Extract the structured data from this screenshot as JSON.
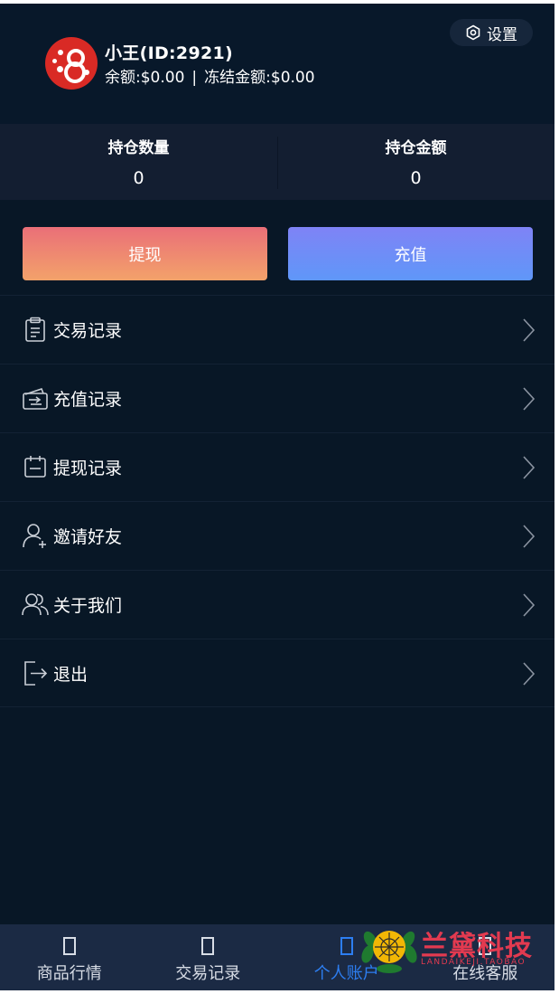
{
  "header": {
    "username": "小王(ID:2921)",
    "balance_label": "余额:",
    "balance_value": "$0.00",
    "separator": "|",
    "frozen_label": "冻结金额:",
    "frozen_value": "$0.00",
    "settings_label": "设置",
    "settings_icon": "gear-icon",
    "avatar_color": "#d92a25"
  },
  "stats": [
    {
      "label": "持仓数量",
      "value": "0"
    },
    {
      "label": "持仓金额",
      "value": "0"
    }
  ],
  "actions": {
    "withdraw_label": "提现",
    "recharge_label": "充值"
  },
  "menu": [
    {
      "label": "交易记录",
      "icon": "clipboard-icon"
    },
    {
      "label": "充值记录",
      "icon": "wallet-icon"
    },
    {
      "label": "提现记录",
      "icon": "calendar-icon"
    },
    {
      "label": "邀请好友",
      "icon": "user-add-icon"
    },
    {
      "label": "关于我们",
      "icon": "users-icon"
    },
    {
      "label": "退出",
      "icon": "logout-icon"
    }
  ],
  "bottom_nav": [
    {
      "label": "商品行情",
      "active": false
    },
    {
      "label": "交易记录",
      "active": false
    },
    {
      "label": "个人账户",
      "active": true
    },
    {
      "label": "在线客服",
      "active": false
    }
  ],
  "watermark": {
    "text": "兰黛科技",
    "sub": "LANDAIKEJI.TAOBAO"
  },
  "colors": {
    "background": "#081726",
    "panel": "#131e31",
    "nav": "#1b2a44",
    "active": "#2d7ef1",
    "withdraw_gradient": [
      "#ea6f78",
      "#f3a26a"
    ],
    "recharge_gradient": [
      "#7f83f6",
      "#5f97f8"
    ]
  }
}
